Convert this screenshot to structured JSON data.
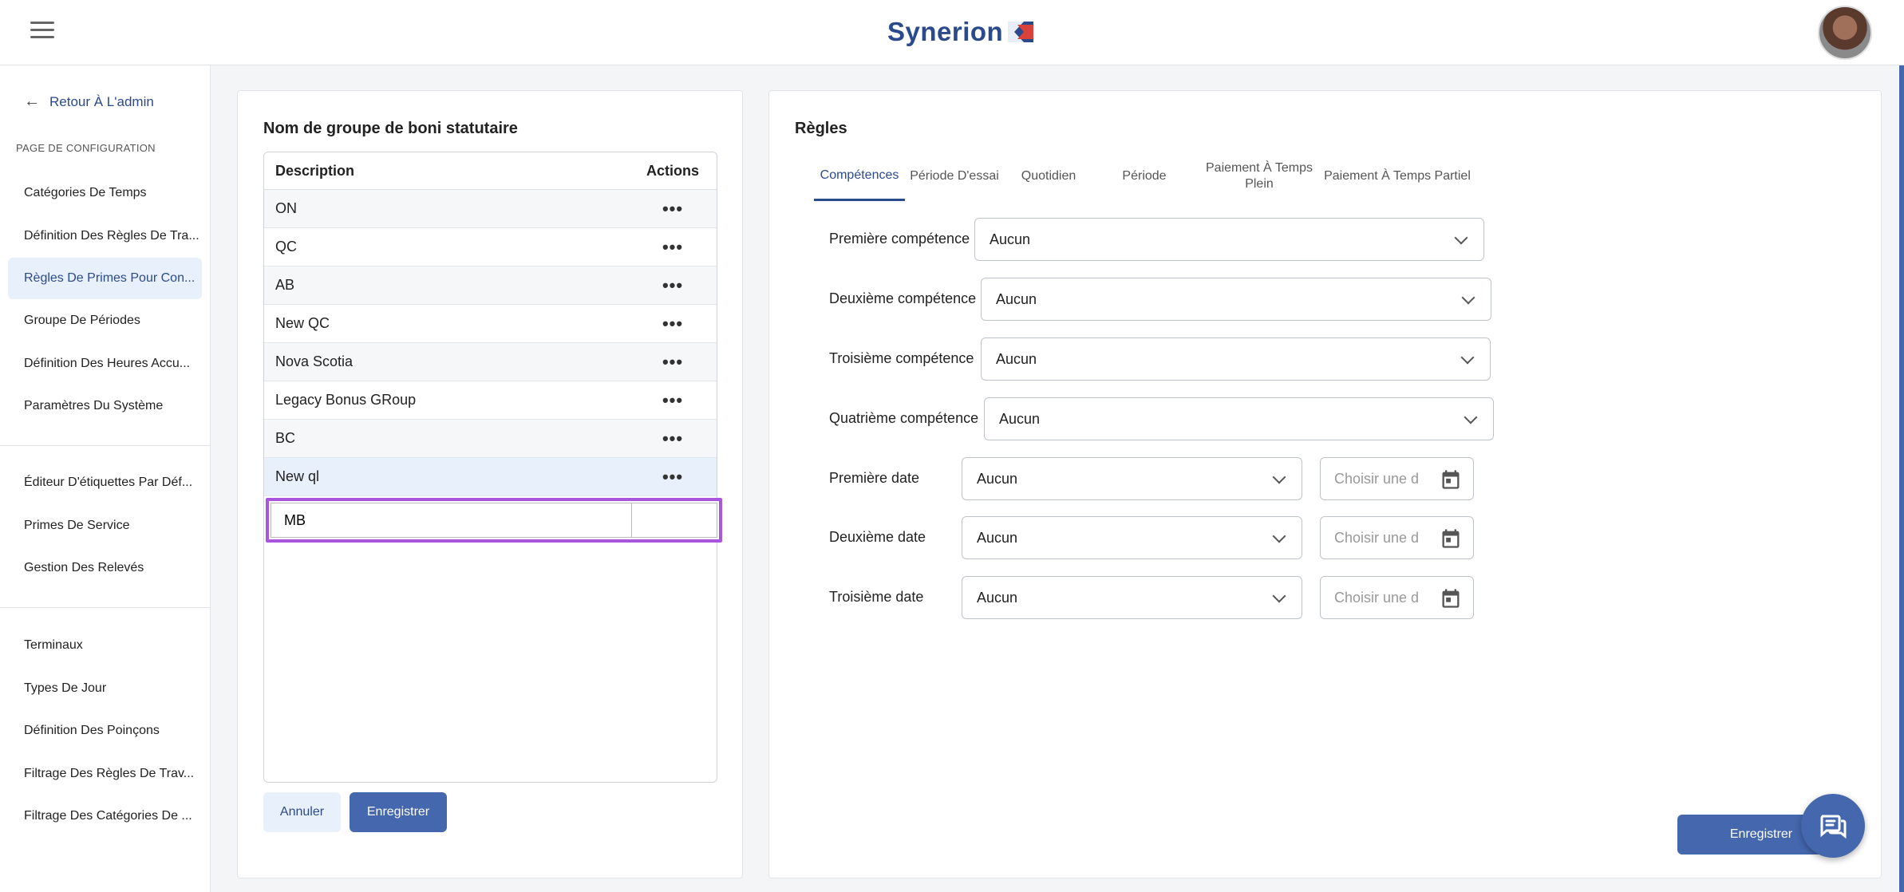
{
  "header": {
    "logo_text": "Synerion"
  },
  "sidebar": {
    "back_label": "Retour À L'admin",
    "section_title": "PAGE DE CONFIGURATION",
    "items": [
      "Catégories De Temps",
      "Définition Des Règles De Tra...",
      "Règles De Primes Pour Con...",
      "Groupe De Périodes",
      "Définition Des Heures Accu...",
      "Paramètres Du Système",
      "Éditeur D'étiquettes Par Déf...",
      "Primes De Service",
      "Gestion Des Relevés",
      "Terminaux",
      "Types De Jour",
      "Définition Des Poinçons",
      "Filtrage Des Règles De Trav...",
      "Filtrage Des Catégories De ..."
    ],
    "active_index": 2
  },
  "left_panel": {
    "title": "Nom de groupe de boni statutaire",
    "col_description": "Description",
    "col_actions": "Actions",
    "rows": [
      "ON",
      "QC",
      "AB",
      "New QC",
      "Nova Scotia",
      "Legacy Bonus GRoup",
      "BC",
      "New ql"
    ],
    "actions_glyph": "•••",
    "edit_value": "MB",
    "cancel_label": "Annuler",
    "save_label": "Enregistrer"
  },
  "right_panel": {
    "title": "Règles",
    "tabs": [
      "Compétences",
      "Période D'essai",
      "Quotidien",
      "Période",
      "Paiement À Temps Plein",
      "Paiement À Temps Partiel"
    ],
    "fields": [
      {
        "label": "Première compétence",
        "value": "Aucun"
      },
      {
        "label": "Deuxième compétence",
        "value": "Aucun"
      },
      {
        "label": "Troisième compétence",
        "value": "Aucun"
      },
      {
        "label": "Quatrième compétence",
        "value": "Aucun"
      }
    ],
    "dates": [
      {
        "label": "Première date",
        "value": "Aucun",
        "placeholder": "Choisir une d"
      },
      {
        "label": "Deuxième date",
        "value": "Aucun",
        "placeholder": "Choisir une d"
      },
      {
        "label": "Troisième date",
        "value": "Aucun",
        "placeholder": "Choisir une d"
      }
    ],
    "save_label": "Enregistrer"
  }
}
